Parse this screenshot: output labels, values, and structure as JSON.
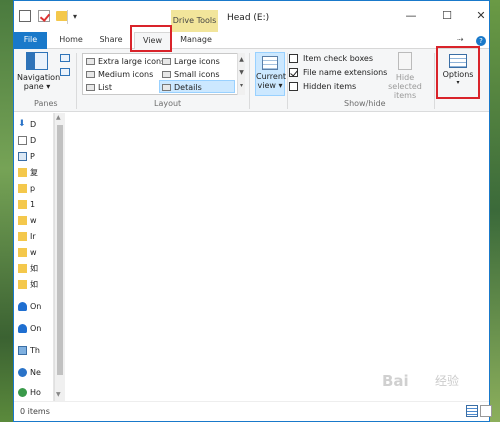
{
  "window": {
    "title": "Head (E:)",
    "contextual_tab": "Drive Tools",
    "controls": {
      "minimize": "—",
      "maximize": "☐",
      "close": "✕"
    }
  },
  "quick_access": {
    "dropdown": "▾"
  },
  "tabs": [
    {
      "label": "File"
    },
    {
      "label": "Home"
    },
    {
      "label": "Share"
    },
    {
      "label": "View"
    },
    {
      "label": "Manage"
    }
  ],
  "tab_right": {
    "pin": "⇢",
    "help": "?"
  },
  "ribbon": {
    "panes": {
      "navigation_pane": "Navigation pane ▾",
      "group_label": "Panes"
    },
    "layout": {
      "group_label": "Layout",
      "items": [
        {
          "label": "Extra large icons"
        },
        {
          "label": "Large icons"
        },
        {
          "label": "Medium icons"
        },
        {
          "label": "Small icons"
        },
        {
          "label": "List"
        },
        {
          "label": "Details"
        }
      ],
      "scroll_up": "▲",
      "scroll_down": "▼",
      "more": "▾"
    },
    "current_view": {
      "label": "Current view ▾"
    },
    "show_hide": {
      "group_label": "Show/hide",
      "item_check_boxes": {
        "label": "Item check boxes",
        "checked": false
      },
      "file_name_extensions": {
        "label": "File name extensions",
        "checked": true
      },
      "hidden_items": {
        "label": "Hidden items",
        "checked": false
      },
      "hide_selected_items": "Hide selected items"
    },
    "options": {
      "label": "Options",
      "caret": "▾"
    }
  },
  "nav_pane": {
    "items": [
      {
        "label": "D",
        "icon": "download-icon"
      },
      {
        "label": "D",
        "icon": "document-icon"
      },
      {
        "label": "P",
        "icon": "pictures-icon"
      },
      {
        "label": "复",
        "icon": "folder-icon"
      },
      {
        "label": "p",
        "icon": "folder-icon"
      },
      {
        "label": "1",
        "icon": "folder-icon"
      },
      {
        "label": "w",
        "icon": "folder-icon"
      },
      {
        "label": "Ir",
        "icon": "folder-icon"
      },
      {
        "label": "w",
        "icon": "folder-icon"
      },
      {
        "label": "如",
        "icon": "folder-icon"
      },
      {
        "label": "如",
        "icon": "folder-icon"
      },
      {
        "label": "On",
        "icon": "onedrive-icon"
      },
      {
        "label": "On",
        "icon": "onedrive-icon"
      },
      {
        "label": "Th",
        "icon": "this-pc-icon"
      },
      {
        "label": "Ne",
        "icon": "network-icon"
      },
      {
        "label": "Ho",
        "icon": "homegroup-icon"
      }
    ],
    "scroll_up": "▲",
    "scroll_down": "▼"
  },
  "status": {
    "text": "0 items"
  },
  "watermark": {
    "text": "Bai",
    "sub": "经验"
  }
}
